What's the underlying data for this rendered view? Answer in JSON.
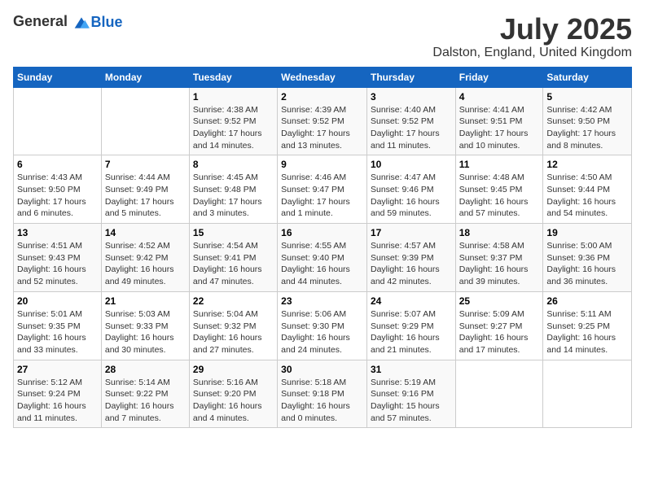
{
  "logo": {
    "general": "General",
    "blue": "Blue"
  },
  "title": "July 2025",
  "subtitle": "Dalston, England, United Kingdom",
  "days_of_week": [
    "Sunday",
    "Monday",
    "Tuesday",
    "Wednesday",
    "Thursday",
    "Friday",
    "Saturday"
  ],
  "weeks": [
    [
      {
        "day": "",
        "info": ""
      },
      {
        "day": "",
        "info": ""
      },
      {
        "day": "1",
        "info": "Sunrise: 4:38 AM\nSunset: 9:52 PM\nDaylight: 17 hours and 14 minutes."
      },
      {
        "day": "2",
        "info": "Sunrise: 4:39 AM\nSunset: 9:52 PM\nDaylight: 17 hours and 13 minutes."
      },
      {
        "day": "3",
        "info": "Sunrise: 4:40 AM\nSunset: 9:52 PM\nDaylight: 17 hours and 11 minutes."
      },
      {
        "day": "4",
        "info": "Sunrise: 4:41 AM\nSunset: 9:51 PM\nDaylight: 17 hours and 10 minutes."
      },
      {
        "day": "5",
        "info": "Sunrise: 4:42 AM\nSunset: 9:50 PM\nDaylight: 17 hours and 8 minutes."
      }
    ],
    [
      {
        "day": "6",
        "info": "Sunrise: 4:43 AM\nSunset: 9:50 PM\nDaylight: 17 hours and 6 minutes."
      },
      {
        "day": "7",
        "info": "Sunrise: 4:44 AM\nSunset: 9:49 PM\nDaylight: 17 hours and 5 minutes."
      },
      {
        "day": "8",
        "info": "Sunrise: 4:45 AM\nSunset: 9:48 PM\nDaylight: 17 hours and 3 minutes."
      },
      {
        "day": "9",
        "info": "Sunrise: 4:46 AM\nSunset: 9:47 PM\nDaylight: 17 hours and 1 minute."
      },
      {
        "day": "10",
        "info": "Sunrise: 4:47 AM\nSunset: 9:46 PM\nDaylight: 16 hours and 59 minutes."
      },
      {
        "day": "11",
        "info": "Sunrise: 4:48 AM\nSunset: 9:45 PM\nDaylight: 16 hours and 57 minutes."
      },
      {
        "day": "12",
        "info": "Sunrise: 4:50 AM\nSunset: 9:44 PM\nDaylight: 16 hours and 54 minutes."
      }
    ],
    [
      {
        "day": "13",
        "info": "Sunrise: 4:51 AM\nSunset: 9:43 PM\nDaylight: 16 hours and 52 minutes."
      },
      {
        "day": "14",
        "info": "Sunrise: 4:52 AM\nSunset: 9:42 PM\nDaylight: 16 hours and 49 minutes."
      },
      {
        "day": "15",
        "info": "Sunrise: 4:54 AM\nSunset: 9:41 PM\nDaylight: 16 hours and 47 minutes."
      },
      {
        "day": "16",
        "info": "Sunrise: 4:55 AM\nSunset: 9:40 PM\nDaylight: 16 hours and 44 minutes."
      },
      {
        "day": "17",
        "info": "Sunrise: 4:57 AM\nSunset: 9:39 PM\nDaylight: 16 hours and 42 minutes."
      },
      {
        "day": "18",
        "info": "Sunrise: 4:58 AM\nSunset: 9:37 PM\nDaylight: 16 hours and 39 minutes."
      },
      {
        "day": "19",
        "info": "Sunrise: 5:00 AM\nSunset: 9:36 PM\nDaylight: 16 hours and 36 minutes."
      }
    ],
    [
      {
        "day": "20",
        "info": "Sunrise: 5:01 AM\nSunset: 9:35 PM\nDaylight: 16 hours and 33 minutes."
      },
      {
        "day": "21",
        "info": "Sunrise: 5:03 AM\nSunset: 9:33 PM\nDaylight: 16 hours and 30 minutes."
      },
      {
        "day": "22",
        "info": "Sunrise: 5:04 AM\nSunset: 9:32 PM\nDaylight: 16 hours and 27 minutes."
      },
      {
        "day": "23",
        "info": "Sunrise: 5:06 AM\nSunset: 9:30 PM\nDaylight: 16 hours and 24 minutes."
      },
      {
        "day": "24",
        "info": "Sunrise: 5:07 AM\nSunset: 9:29 PM\nDaylight: 16 hours and 21 minutes."
      },
      {
        "day": "25",
        "info": "Sunrise: 5:09 AM\nSunset: 9:27 PM\nDaylight: 16 hours and 17 minutes."
      },
      {
        "day": "26",
        "info": "Sunrise: 5:11 AM\nSunset: 9:25 PM\nDaylight: 16 hours and 14 minutes."
      }
    ],
    [
      {
        "day": "27",
        "info": "Sunrise: 5:12 AM\nSunset: 9:24 PM\nDaylight: 16 hours and 11 minutes."
      },
      {
        "day": "28",
        "info": "Sunrise: 5:14 AM\nSunset: 9:22 PM\nDaylight: 16 hours and 7 minutes."
      },
      {
        "day": "29",
        "info": "Sunrise: 5:16 AM\nSunset: 9:20 PM\nDaylight: 16 hours and 4 minutes."
      },
      {
        "day": "30",
        "info": "Sunrise: 5:18 AM\nSunset: 9:18 PM\nDaylight: 16 hours and 0 minutes."
      },
      {
        "day": "31",
        "info": "Sunrise: 5:19 AM\nSunset: 9:16 PM\nDaylight: 15 hours and 57 minutes."
      },
      {
        "day": "",
        "info": ""
      },
      {
        "day": "",
        "info": ""
      }
    ]
  ]
}
